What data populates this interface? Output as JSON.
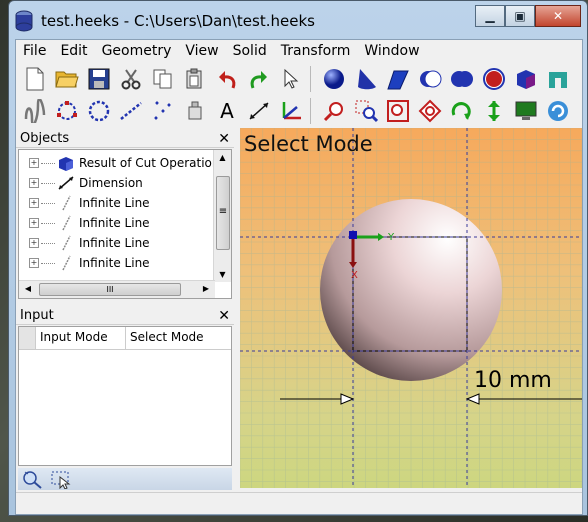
{
  "window": {
    "title": "test.heeks - C:\\Users\\Dan\\test.heeks",
    "app_icon": "cylinder-icon",
    "controls": [
      "minimize-icon",
      "maximize-icon",
      "close-icon"
    ]
  },
  "menubar": [
    "File",
    "Edit",
    "Geometry",
    "View",
    "Solid",
    "Transform",
    "Window"
  ],
  "toolbar1": {
    "file_tools": [
      "new-file-icon",
      "open-folder-icon",
      "save-icon",
      "cut-icon",
      "copy-icon",
      "paste-icon",
      "undo-icon",
      "redo-icon",
      "select-pointer-icon"
    ],
    "solid_tools": [
      "sphere-icon",
      "cone-icon",
      "cylinder-icon",
      "subtract-icon",
      "union-icon",
      "intersect-icon",
      "cube-icon",
      "extrude-icon"
    ]
  },
  "toolbar2": {
    "geometry_tools": [
      "spline-icon",
      "circle-3pt-icon",
      "circle-dotted-icon",
      "line-icon",
      "points-icon",
      "gear-icon"
    ],
    "text_label": "A",
    "geometry_tools_2": [
      "dimension-icon",
      "coordinate-system-icon"
    ],
    "view_tools": [
      "previous-view-icon",
      "zoom-window-icon",
      "fit-view-icon",
      "view-front-icon",
      "rotate-icon",
      "view-top-icon",
      "view-screen-icon",
      "refresh-icon"
    ]
  },
  "objects_panel": {
    "title": "Objects",
    "close_label": "✕",
    "items": [
      {
        "label": "Result of Cut Operation",
        "icon": "solid-icon"
      },
      {
        "label": "Dimension",
        "icon": "dimension-icon"
      },
      {
        "label": "Infinite Line",
        "icon": "infinite-line-icon"
      },
      {
        "label": "Infinite Line",
        "icon": "infinite-line-icon"
      },
      {
        "label": "Infinite Line",
        "icon": "infinite-line-icon"
      },
      {
        "label": "Infinite Line",
        "icon": "infinite-line-icon"
      }
    ],
    "hscroll_grip": "III",
    "vscroll_grip": "≡"
  },
  "input_panel": {
    "title": "Input",
    "close_label": "✕",
    "columns": [
      "Input Mode",
      "Select Mode"
    ],
    "bottom_icons": [
      "magic-wand-icon",
      "select-tool-icon"
    ]
  },
  "viewport": {
    "mode_label": "Select Mode",
    "dimension_text": "10 mm",
    "axis_y_label": "Y",
    "axis_x_label": "X",
    "colors": {
      "background_top": "#f6a95c",
      "background_bottom": "#cdd680",
      "grid": "#7b8f7a",
      "sphere": "#e7cfd0",
      "axis_y": "#1aa11a",
      "axis_x": "#b01010",
      "axis_z": "#1010b0"
    }
  }
}
